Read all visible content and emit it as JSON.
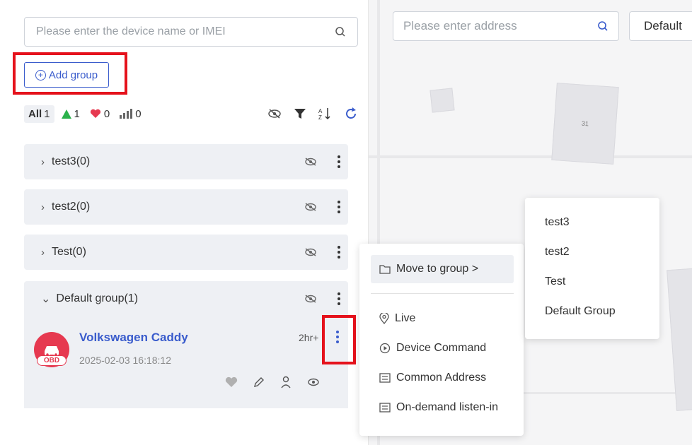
{
  "search": {
    "placeholder": "Please enter the device name or IMEI"
  },
  "add_group": {
    "label": "Add group"
  },
  "filters": {
    "all_label": "All",
    "all_count": "1",
    "online_count": "1",
    "favorite_count": "0",
    "signal_count": "0"
  },
  "groups": [
    {
      "label": "test3(0)"
    },
    {
      "label": "test2(0)"
    },
    {
      "label": "Test(0)"
    }
  ],
  "default_group": {
    "label": "Default group(1)"
  },
  "device": {
    "name": "Volkswagen Caddy",
    "timestamp": "2025-02-03 16:18:12",
    "ago": "2hr+",
    "badge": "OBD"
  },
  "context_menu": {
    "move_to_group": "Move to group >",
    "live": "Live",
    "device_command": "Device Command",
    "common_address": "Common Address",
    "on_demand_listen": "On-demand listen-in"
  },
  "submenu": [
    "test3",
    "test2",
    "Test",
    "Default Group"
  ],
  "map": {
    "address_placeholder": "Please enter address",
    "default_label": "Default",
    "block_label": "31"
  },
  "colors": {
    "accent": "#3a5ccc",
    "highlight": "#e5121c",
    "avatar": "#e63950"
  }
}
